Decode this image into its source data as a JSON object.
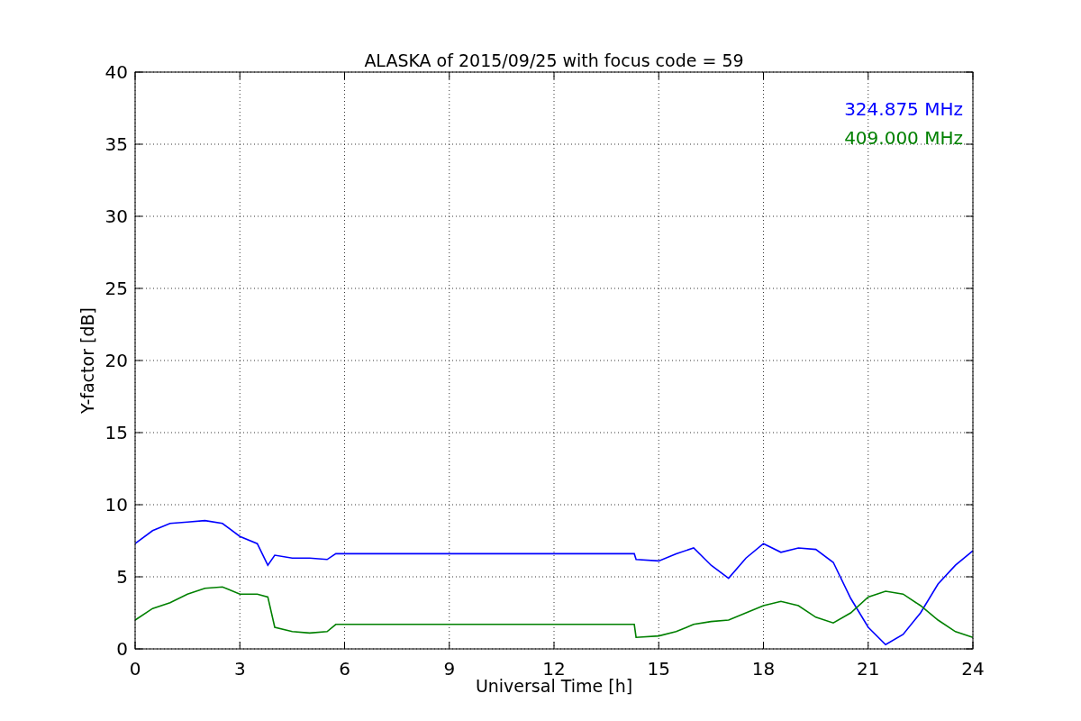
{
  "chart": {
    "chart_data": {
      "type": "line",
      "title": "ALASKA of 2015/09/25 with focus code = 59",
      "xlabel": "Universal Time [h]",
      "ylabel": "Y-factor [dB]",
      "x": [
        0,
        0.5,
        1,
        1.5,
        2,
        2.5,
        3,
        3.5,
        3.8,
        4,
        4.5,
        5,
        5.5,
        5.75,
        14.3,
        14.35,
        15,
        15.5,
        16,
        16.5,
        17,
        17.5,
        18,
        18.5,
        19,
        19.5,
        20,
        20.5,
        21,
        21.5,
        22,
        22.5,
        23,
        23.5,
        24
      ],
      "series": [
        {
          "name": "324.875 MHz",
          "color": "#0000ff",
          "values": [
            7.3,
            8.2,
            8.7,
            8.8,
            8.9,
            8.7,
            7.8,
            7.3,
            5.8,
            6.5,
            6.3,
            6.3,
            6.2,
            6.6,
            6.6,
            6.2,
            6.1,
            6.6,
            7.0,
            5.8,
            4.9,
            6.3,
            7.3,
            6.7,
            7.0,
            6.9,
            6.0,
            3.5,
            1.5,
            0.3,
            1.0,
            2.5,
            4.5,
            5.8,
            6.8
          ]
        },
        {
          "name": "409.000 MHz",
          "color": "#008000",
          "values": [
            2.0,
            2.8,
            3.2,
            3.8,
            4.2,
            4.3,
            3.8,
            3.8,
            3.6,
            1.5,
            1.2,
            1.1,
            1.2,
            1.7,
            1.7,
            0.8,
            0.9,
            1.2,
            1.7,
            1.9,
            2.0,
            2.5,
            3.0,
            3.3,
            3.0,
            2.2,
            1.8,
            2.5,
            3.6,
            4.0,
            3.8,
            3.0,
            2.0,
            1.2,
            0.8
          ]
        }
      ],
      "grid": true,
      "xlim": [
        0,
        24
      ],
      "ylim": [
        0,
        40
      ],
      "xticks": [
        0,
        3,
        6,
        9,
        12,
        15,
        18,
        21,
        24
      ],
      "yticks": [
        0,
        5,
        10,
        15,
        20,
        25,
        30,
        35,
        40
      ]
    }
  }
}
